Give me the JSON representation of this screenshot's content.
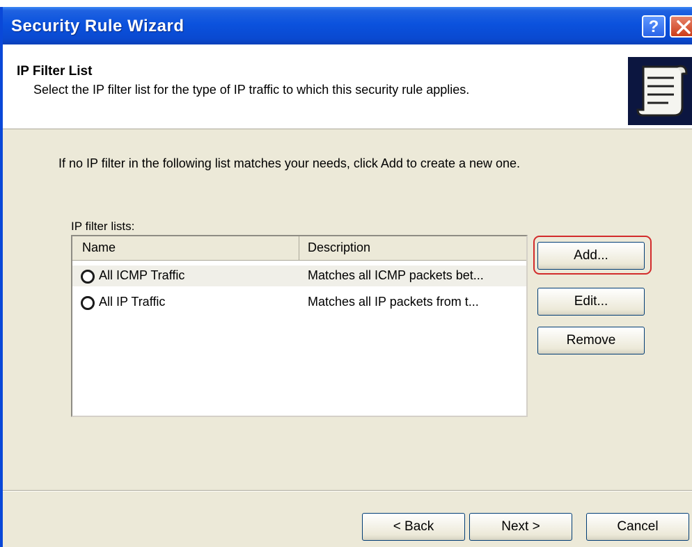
{
  "window": {
    "title": "Security Rule Wizard",
    "help_glyph": "?"
  },
  "header": {
    "title": "IP Filter List",
    "subtitle": "Select the IP filter list for the type of IP traffic to which this security rule applies.",
    "icon": "scroll-list-icon"
  },
  "body": {
    "intro": "If no IP filter in the following list matches your needs, click Add to create a new one.",
    "list_label": "IP filter lists:"
  },
  "list": {
    "columns": [
      "Name",
      "Description"
    ],
    "rows": [
      {
        "name": "All ICMP Traffic",
        "description": "Matches all ICMP packets bet..."
      },
      {
        "name": "All IP Traffic",
        "description": "Matches all IP packets from t..."
      }
    ]
  },
  "side_buttons": {
    "add": "Add...",
    "edit": "Edit...",
    "remove": "Remove"
  },
  "footer": {
    "back": "< Back",
    "next": "Next >",
    "cancel": "Cancel"
  },
  "colors": {
    "titlebar": "#0b52de",
    "highlight": "#d22b2b",
    "dialog_bg": "#ece9d8"
  }
}
